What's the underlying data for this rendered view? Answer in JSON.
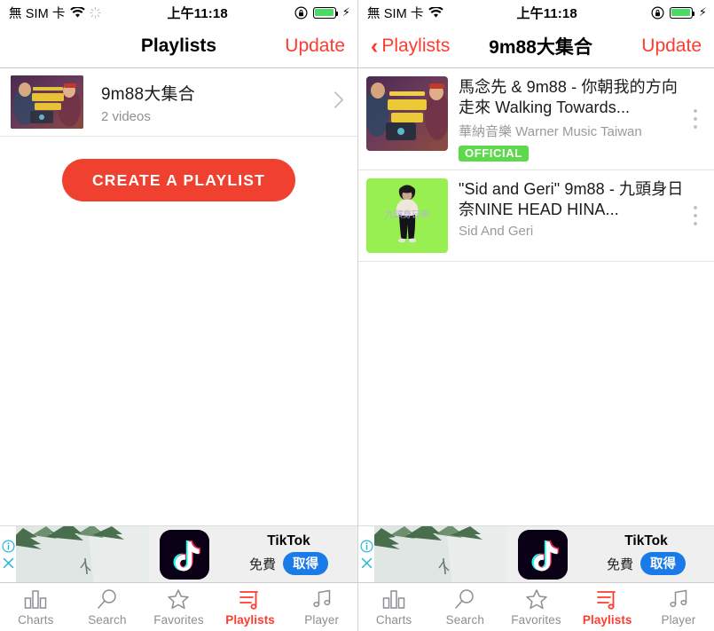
{
  "statusbar": {
    "carrier": "無 SIM 卡",
    "wifi_icon": "wifi-icon",
    "sunburst_icon": "sunburst-icon",
    "time": "上午11:18",
    "rotation_lock_icon": "rotation-lock-icon",
    "battery_icon": "battery-icon",
    "battery_color": "#4cd964",
    "charging_icon": "lightning-bolt-icon"
  },
  "accent_color": "#ff3b30",
  "left_panel": {
    "navbar": {
      "title": "Playlists",
      "action": "Update"
    },
    "playlists": [
      {
        "title": "9m88大集合",
        "subtitle": "2 videos",
        "chevron": "chevron-right-icon"
      }
    ],
    "create_button": "CREATE A PLAYLIST"
  },
  "right_panel": {
    "navbar": {
      "back": "Playlists",
      "back_icon": "chevron-left-icon",
      "title": "9m88大集合",
      "action": "Update"
    },
    "videos": [
      {
        "title": "馬念先 & 9m88 - 你朝我的方向走來 Walking Towards...",
        "channel": "華納音樂 Warner Music Taiwan",
        "badge": "OFFICIAL",
        "badge_color": "#5ed94e",
        "menu_icon": "kebab-menu-icon"
      },
      {
        "title": "\"Sid and Geri\" 9m88 - 九頭身日奈NINE HEAD HINA...",
        "channel": "Sid And Geri",
        "badge": null,
        "menu_icon": "kebab-menu-icon"
      }
    ]
  },
  "ad": {
    "info_icon": "info-icon",
    "close_icon": "close-icon",
    "app_icon": "tiktok-logo-icon",
    "title": "TikTok",
    "price": "免費",
    "cta": "取得",
    "cta_color": "#1a7ae8"
  },
  "tabbar": {
    "tabs": [
      {
        "label": "Charts",
        "icon": "bar-chart-icon",
        "active": false
      },
      {
        "label": "Search",
        "icon": "magnifier-icon",
        "active": false
      },
      {
        "label": "Favorites",
        "icon": "star-icon",
        "active": false
      },
      {
        "label": "Playlists",
        "icon": "playlist-note-icon",
        "active": true
      },
      {
        "label": "Player",
        "icon": "music-note-icon",
        "active": false
      }
    ]
  }
}
